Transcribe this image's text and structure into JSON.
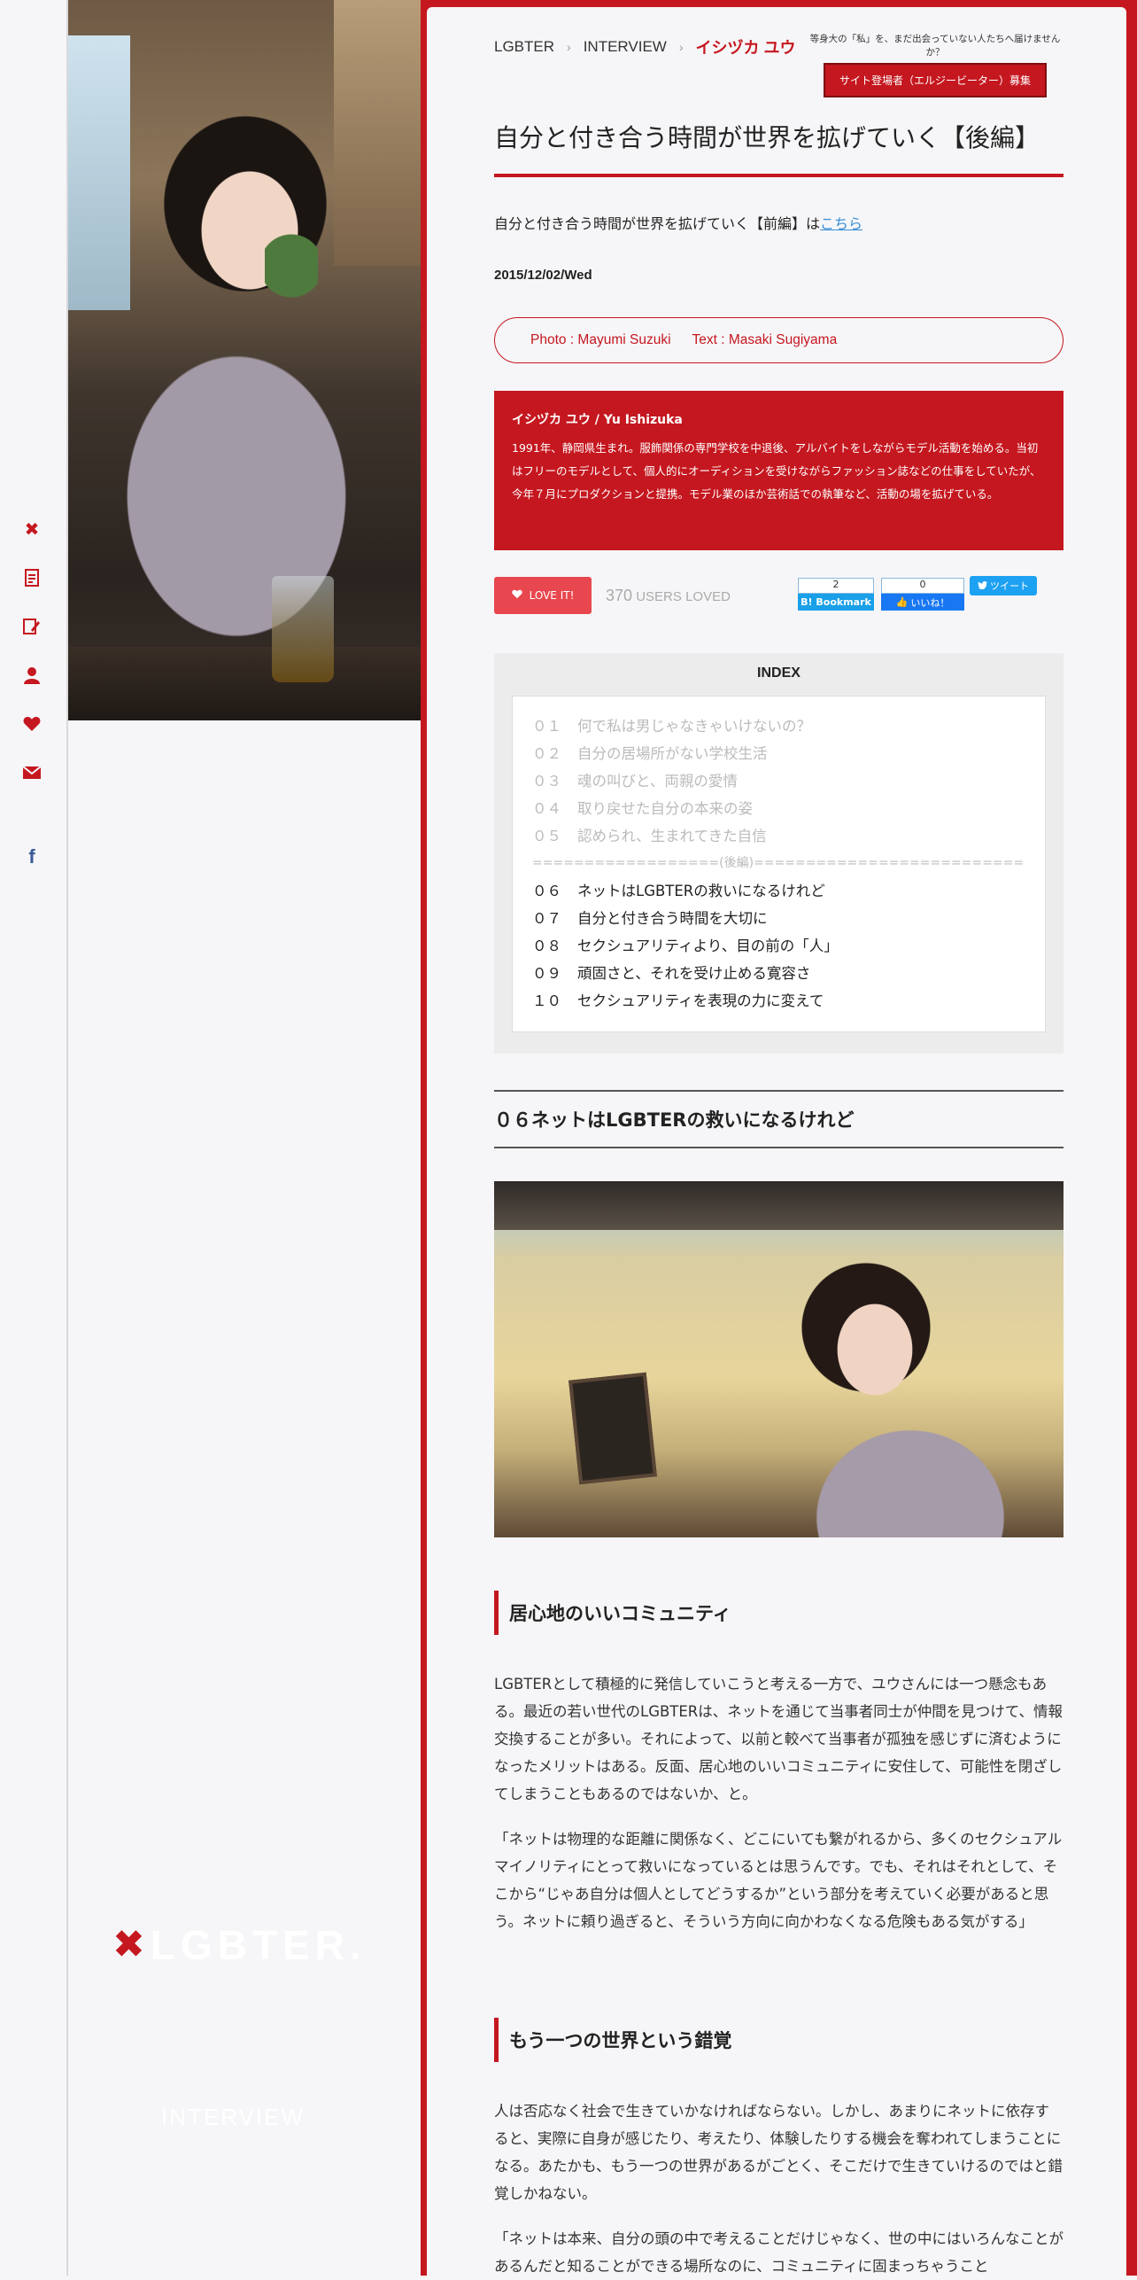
{
  "rail": {
    "icons": [
      "logo-x-icon",
      "document-icon",
      "edit-icon",
      "user-icon",
      "heart-icon",
      "mail-icon",
      "facebook-icon"
    ],
    "facebook_glyph": "f"
  },
  "sidebar": {
    "brand_text": "LGBTER.",
    "category": "INTERVIEW"
  },
  "breadcrumb": {
    "items": [
      "LGBTER",
      "INTERVIEW"
    ],
    "current": "イシヅカ ユウ"
  },
  "recruit": {
    "tagline": "等身大の「私」を、まだ出会っていない人たちへ届けませんか？",
    "button": "サイト登場者（エルジービーター）募集"
  },
  "article": {
    "title": "自分と付き合う時間が世界を拡げていく【後編】",
    "prev_text": "自分と付き合う時間が世界を拡げていく【前編】は",
    "prev_link": "こちら",
    "date": "2015/12/02/Wed",
    "photo_credit": "Photo : Mayumi Suzuki",
    "text_credit": "Text : Masaki Sugiyama"
  },
  "profile": {
    "name": "イシヅカ ユウ / Yu Ishizuka",
    "bio": "1991年、静岡県生まれ。服飾関係の専門学校を中退後、アルバイトをしながらモデル活動を始める。当初はフリーのモデルとして、個人的にオーディションを受けながらファッション誌などの仕事をしていたが、今年７月にプロダクションと提携。モデル業のほか芸術話での執筆など、活動の場を拡げている。"
  },
  "social": {
    "love_label": "LOVE IT!",
    "loved_count": "370",
    "loved_label": "USERS LOVED",
    "hatena_count": "2",
    "hatena_label": "B! Bookmark",
    "fb_count": "0",
    "fb_label": "いいね！",
    "tweet_label": "ツイート"
  },
  "index": {
    "heading": "INDEX",
    "items": [
      {
        "num": "０１",
        "text": "何で私は男じゃなきゃいけないの？"
      },
      {
        "num": "０２",
        "text": "自分の居場所がない学校生活"
      },
      {
        "num": "０３",
        "text": "魂の叫びと、両親の愛情"
      },
      {
        "num": "０４",
        "text": "取り戻せた自分の本来の姿"
      },
      {
        "num": "０５",
        "text": "認められ、生まれてきた自信"
      },
      {
        "num": "",
        "text": "==================(後編)=========================="
      },
      {
        "num": "０６",
        "text": "ネットはLGBTERの救いになるけれど"
      },
      {
        "num": "０７",
        "text": "自分と付き合う時間を大切に"
      },
      {
        "num": "０８",
        "text": "セクシュアリティより、目の前の「人」"
      },
      {
        "num": "０９",
        "text": "頑固さと、それを受け止める寛容さ"
      },
      {
        "num": "１０",
        "text": "セクシュアリティを表現の力に変えて"
      }
    ]
  },
  "section": {
    "heading": "０６ネットはLGBTERの救いになるけれど",
    "sub1": "居心地のいいコミュニティ",
    "p1": "LGBTERとして積極的に発信していこうと考える一方で、ユウさんには一つ懸念もある。最近の若い世代のLGBTERは、ネットを通じて当事者同士が仲間を見つけて、情報交換することが多い。それによって、以前と較べて当事者が孤独を感じずに済むようになったメリットはある。反面、居心地のいいコミュニティに安住して、可能性を閉ざしてしまうこともあるのではないか、と。",
    "p2": "「ネットは物理的な距離に関係なく、どこにいても繋がれるから、多くのセクシュアルマイノリティにとって救いになっているとは思うんです。でも、それはそれとして、そこから“じゃあ自分は個人としてどうするか”という部分を考えていく必要があると思う。ネットに頼り過ぎると、そういう方向に向かわなくなる危険もある気がする」",
    "sub2": "もう一つの世界という錯覚",
    "p3": "人は否応なく社会で生きていかなければならない。しかし、あまりにネットに依存すると、実際に自身が感じたり、考えたり、体験したりする機会を奪われてしまうことになる。あたかも、もう一つの世界があるがごとく、そこだけで生きていけるのではと錯覚しかねない。",
    "p4": "「ネットは本来、自分の頭の中で考えることだけじゃなく、世の中にはいろんなことがあるんだと知ることができる場所なのに、コミュニティに固まっちゃうこと"
  }
}
